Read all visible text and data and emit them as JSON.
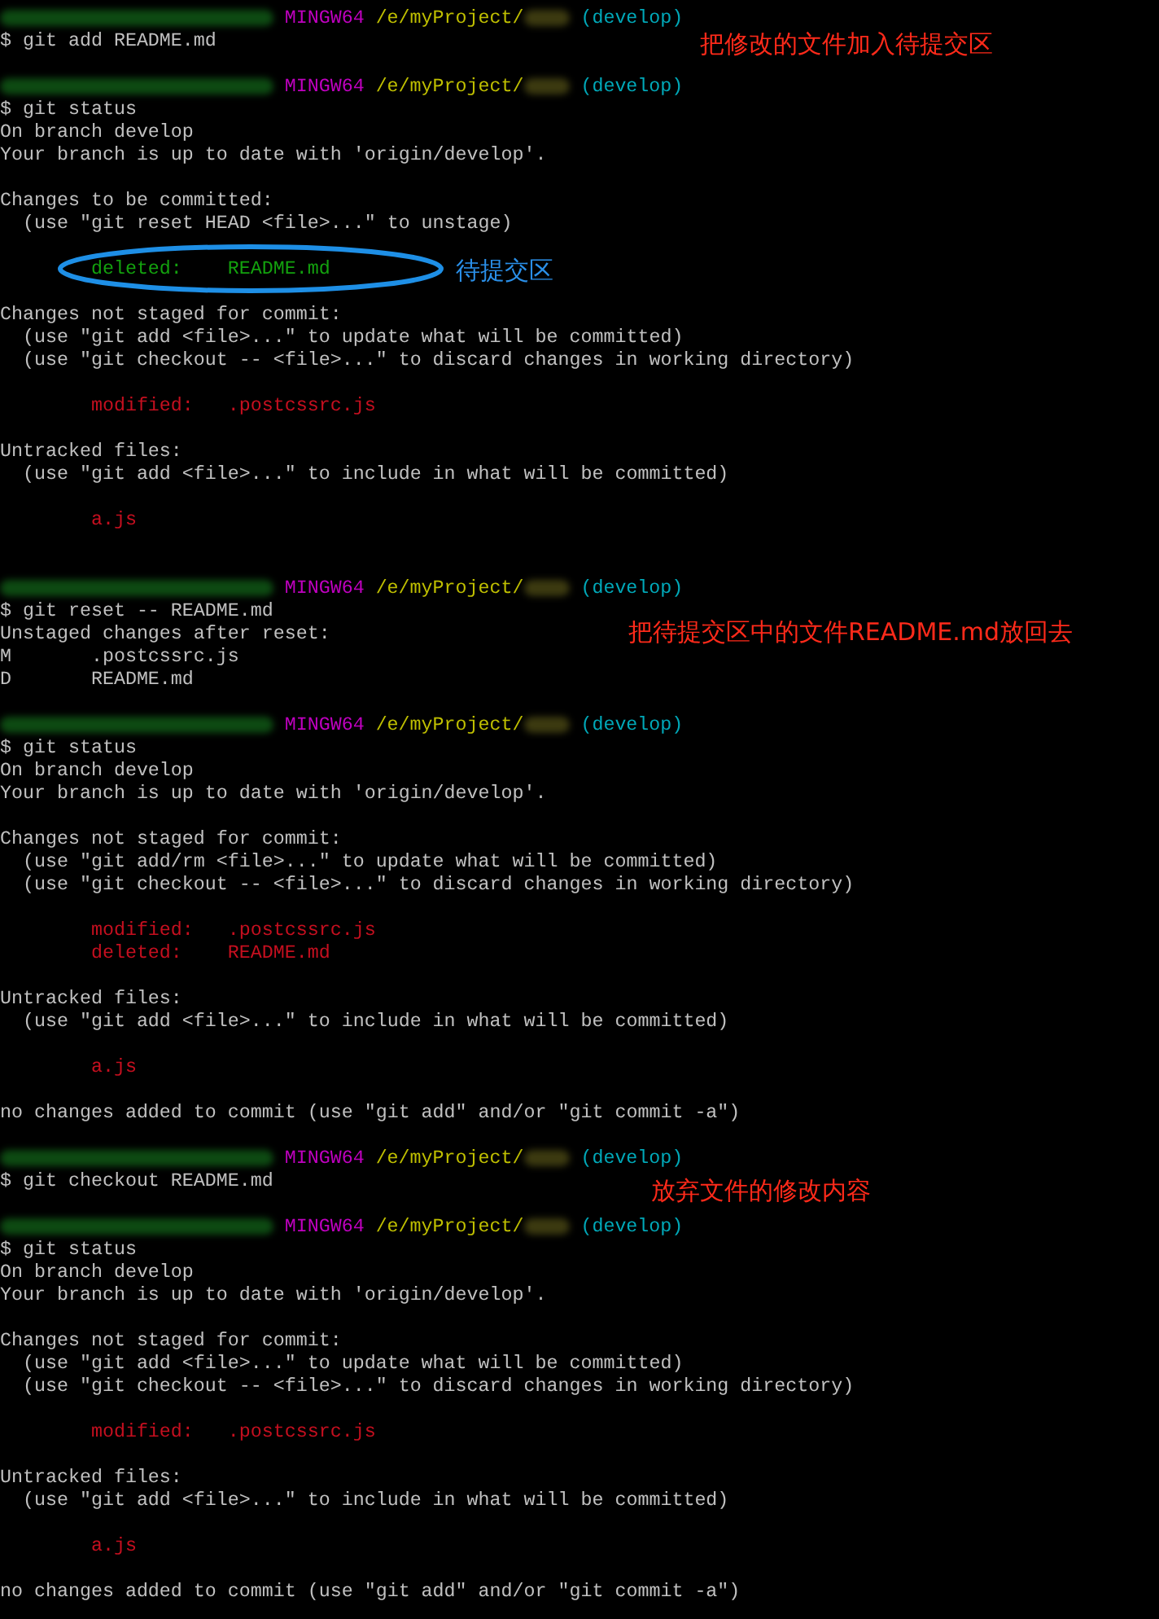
{
  "terminal": {
    "lines": [
      {
        "kind": "prompt",
        "system": "MINGW64",
        "path": "/e/myProject/",
        "branch": "(develop)"
      },
      {
        "kind": "text",
        "text": "$ git add README.md",
        "note": {
          "kind": "red",
          "text": "把修改的文件加入待提交区"
        }
      },
      {
        "kind": "blank"
      },
      {
        "kind": "prompt",
        "system": "MINGW64",
        "path": "/e/myProject/",
        "branch": "(develop)"
      },
      {
        "kind": "text",
        "text": "$ git status"
      },
      {
        "kind": "text",
        "text": "On branch develop"
      },
      {
        "kind": "text",
        "text": "Your branch is up to date with 'origin/develop'."
      },
      {
        "kind": "blank"
      },
      {
        "kind": "text",
        "text": "Changes to be committed:"
      },
      {
        "kind": "text",
        "text": "  (use \"git reset HEAD <file>...\" to unstage)"
      },
      {
        "kind": "blank"
      },
      {
        "kind": "file",
        "color": "#13a10e",
        "text": "        deleted:    README.md",
        "circled": true,
        "note": {
          "kind": "blue",
          "text": "待提交区"
        }
      },
      {
        "kind": "blank"
      },
      {
        "kind": "text",
        "text": "Changes not staged for commit:"
      },
      {
        "kind": "text",
        "text": "  (use \"git add <file>...\" to update what will be committed)"
      },
      {
        "kind": "text",
        "text": "  (use \"git checkout -- <file>...\" to discard changes in working directory)"
      },
      {
        "kind": "blank"
      },
      {
        "kind": "file",
        "color": "#c50f1f",
        "text": "        modified:   .postcssrc.js"
      },
      {
        "kind": "blank"
      },
      {
        "kind": "text",
        "text": "Untracked files:"
      },
      {
        "kind": "text",
        "text": "  (use \"git add <file>...\" to include in what will be committed)"
      },
      {
        "kind": "blank"
      },
      {
        "kind": "file",
        "color": "#c50f1f",
        "text": "        a.js"
      },
      {
        "kind": "blank"
      },
      {
        "kind": "blank"
      },
      {
        "kind": "prompt",
        "system": "MINGW64",
        "path": "/e/myProject/",
        "branch": "(develop)"
      },
      {
        "kind": "text",
        "text": "$ git reset -- README.md"
      },
      {
        "kind": "text",
        "text": "Unstaged changes after reset:",
        "note": {
          "kind": "red",
          "text": "把待提交区中的文件README.md放回去"
        }
      },
      {
        "kind": "text",
        "text": "M       .postcssrc.js"
      },
      {
        "kind": "text",
        "text": "D       README.md"
      },
      {
        "kind": "blank"
      },
      {
        "kind": "prompt",
        "system": "MINGW64",
        "path": "/e/myProject/",
        "branch": "(develop)"
      },
      {
        "kind": "text",
        "text": "$ git status"
      },
      {
        "kind": "text",
        "text": "On branch develop"
      },
      {
        "kind": "text",
        "text": "Your branch is up to date with 'origin/develop'."
      },
      {
        "kind": "blank"
      },
      {
        "kind": "text",
        "text": "Changes not staged for commit:"
      },
      {
        "kind": "text",
        "text": "  (use \"git add/rm <file>...\" to update what will be committed)"
      },
      {
        "kind": "text",
        "text": "  (use \"git checkout -- <file>...\" to discard changes in working directory)"
      },
      {
        "kind": "blank"
      },
      {
        "kind": "file",
        "color": "#c50f1f",
        "text": "        modified:   .postcssrc.js"
      },
      {
        "kind": "file",
        "color": "#c50f1f",
        "text": "        deleted:    README.md"
      },
      {
        "kind": "blank"
      },
      {
        "kind": "text",
        "text": "Untracked files:"
      },
      {
        "kind": "text",
        "text": "  (use \"git add <file>...\" to include in what will be committed)"
      },
      {
        "kind": "blank"
      },
      {
        "kind": "file",
        "color": "#c50f1f",
        "text": "        a.js"
      },
      {
        "kind": "blank"
      },
      {
        "kind": "text",
        "text": "no changes added to commit (use \"git add\" and/or \"git commit -a\")"
      },
      {
        "kind": "blank"
      },
      {
        "kind": "prompt",
        "system": "MINGW64",
        "path": "/e/myProject/",
        "branch": "(develop)"
      },
      {
        "kind": "text",
        "text": "$ git checkout README.md"
      },
      {
        "kind": "blank",
        "note": {
          "kind": "red",
          "text": "放弃文件的修改内容"
        }
      },
      {
        "kind": "prompt",
        "system": "MINGW64",
        "path": "/e/myProject/",
        "branch": "(develop)"
      },
      {
        "kind": "text",
        "text": "$ git status"
      },
      {
        "kind": "text",
        "text": "On branch develop"
      },
      {
        "kind": "text",
        "text": "Your branch is up to date with 'origin/develop'."
      },
      {
        "kind": "blank"
      },
      {
        "kind": "text",
        "text": "Changes not staged for commit:"
      },
      {
        "kind": "text",
        "text": "  (use \"git add <file>...\" to update what will be committed)"
      },
      {
        "kind": "text",
        "text": "  (use \"git checkout -- <file>...\" to discard changes in working directory)"
      },
      {
        "kind": "blank"
      },
      {
        "kind": "file",
        "color": "#c50f1f",
        "text": "        modified:   .postcssrc.js"
      },
      {
        "kind": "blank"
      },
      {
        "kind": "text",
        "text": "Untracked files:"
      },
      {
        "kind": "text",
        "text": "  (use \"git add <file>...\" to include in what will be committed)"
      },
      {
        "kind": "blank"
      },
      {
        "kind": "file",
        "color": "#c50f1f",
        "text": "        a.js"
      },
      {
        "kind": "blank"
      },
      {
        "kind": "text",
        "text": "no changes added to commit (use \"git add\" and/or \"git commit -a\")"
      }
    ]
  }
}
